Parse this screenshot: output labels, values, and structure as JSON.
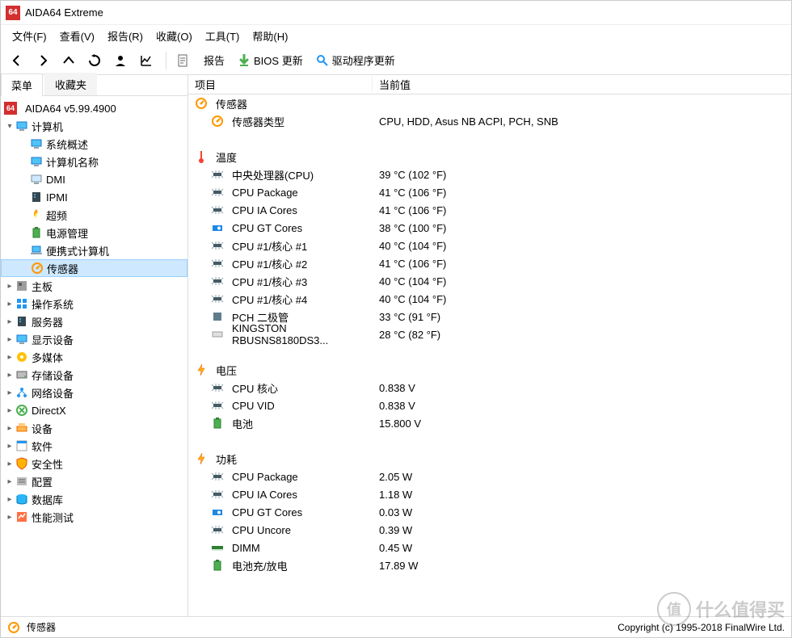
{
  "window": {
    "title": "AIDA64 Extreme",
    "app_badge": "64"
  },
  "menubar": [
    "文件(F)",
    "查看(V)",
    "报告(R)",
    "收藏(O)",
    "工具(T)",
    "帮助(H)"
  ],
  "toolbar": {
    "report": "报告",
    "bios_update": "BIOS 更新",
    "driver_update": "驱动程序更新"
  },
  "sidebar": {
    "tabs": {
      "menu": "菜单",
      "favorites": "收藏夹"
    },
    "root": "AIDA64 v5.99.4900",
    "computer": {
      "label": "计算机",
      "children": [
        {
          "label": "系统概述",
          "icon": "monitor"
        },
        {
          "label": "计算机名称",
          "icon": "monitor"
        },
        {
          "label": "DMI",
          "icon": "monitor-blank"
        },
        {
          "label": "IPMI",
          "icon": "server"
        },
        {
          "label": "超频",
          "icon": "flame"
        },
        {
          "label": "电源管理",
          "icon": "battery"
        },
        {
          "label": "便携式计算机",
          "icon": "laptop"
        },
        {
          "label": "传感器",
          "icon": "sensor",
          "selected": true
        }
      ]
    },
    "others": [
      {
        "label": "主板",
        "icon": "board"
      },
      {
        "label": "操作系统",
        "icon": "windows"
      },
      {
        "label": "服务器",
        "icon": "server"
      },
      {
        "label": "显示设备",
        "icon": "monitor"
      },
      {
        "label": "多媒体",
        "icon": "media"
      },
      {
        "label": "存储设备",
        "icon": "drive"
      },
      {
        "label": "网络设备",
        "icon": "network"
      },
      {
        "label": "DirectX",
        "icon": "directx"
      },
      {
        "label": "设备",
        "icon": "devices"
      },
      {
        "label": "软件",
        "icon": "software"
      },
      {
        "label": "安全性",
        "icon": "shield"
      },
      {
        "label": "配置",
        "icon": "config"
      },
      {
        "label": "数据库",
        "icon": "database"
      },
      {
        "label": "性能测试",
        "icon": "benchmark"
      }
    ]
  },
  "columns": {
    "item": "项目",
    "value": "当前值"
  },
  "groups": [
    {
      "title": "传感器",
      "icon": "sensor",
      "rows": [
        {
          "label": "传感器类型",
          "value": "CPU, HDD, Asus NB ACPI, PCH, SNB",
          "icon": "sensor"
        }
      ]
    },
    {
      "title": "温度",
      "icon": "thermo",
      "rows": [
        {
          "label": "中央处理器(CPU)",
          "value": "39 °C  (102 °F)",
          "icon": "chip"
        },
        {
          "label": "CPU Package",
          "value": "41 °C  (106 °F)",
          "icon": "chip"
        },
        {
          "label": "CPU IA Cores",
          "value": "41 °C  (106 °F)",
          "icon": "chip"
        },
        {
          "label": "CPU GT Cores",
          "value": "38 °C  (100 °F)",
          "icon": "gpu"
        },
        {
          "label": "CPU #1/核心 #1",
          "value": "40 °C  (104 °F)",
          "icon": "chip"
        },
        {
          "label": "CPU #1/核心 #2",
          "value": "41 °C  (106 °F)",
          "icon": "chip"
        },
        {
          "label": "CPU #1/核心 #3",
          "value": "40 °C  (104 °F)",
          "icon": "chip"
        },
        {
          "label": "CPU #1/核心 #4",
          "value": "40 °C  (104 °F)",
          "icon": "chip"
        },
        {
          "label": "PCH 二极管",
          "value": "33 °C  (91 °F)",
          "icon": "pch"
        },
        {
          "label": "KINGSTON RBUSNS8180DS3...",
          "value": "28 °C  (82 °F)",
          "icon": "ssd"
        }
      ]
    },
    {
      "title": "电压",
      "icon": "bolt",
      "rows": [
        {
          "label": "CPU 核心",
          "value": "0.838 V",
          "icon": "chip"
        },
        {
          "label": "CPU VID",
          "value": "0.838 V",
          "icon": "chip"
        },
        {
          "label": "电池",
          "value": "15.800 V",
          "icon": "battery"
        }
      ]
    },
    {
      "title": "功耗",
      "icon": "bolt",
      "rows": [
        {
          "label": "CPU Package",
          "value": "2.05 W",
          "icon": "chip"
        },
        {
          "label": "CPU IA Cores",
          "value": "1.18 W",
          "icon": "chip"
        },
        {
          "label": "CPU GT Cores",
          "value": "0.03 W",
          "icon": "gpu"
        },
        {
          "label": "CPU Uncore",
          "value": "0.39 W",
          "icon": "chip"
        },
        {
          "label": "DIMM",
          "value": "0.45 W",
          "icon": "dimm"
        },
        {
          "label": "电池充/放电",
          "value": "17.89 W",
          "icon": "battery"
        }
      ]
    }
  ],
  "statusbar": {
    "left": "传感器",
    "right": "Copyright (c) 1995-2018 FinalWire Ltd."
  },
  "watermark": {
    "badge": "值",
    "text": "什么值得买"
  }
}
